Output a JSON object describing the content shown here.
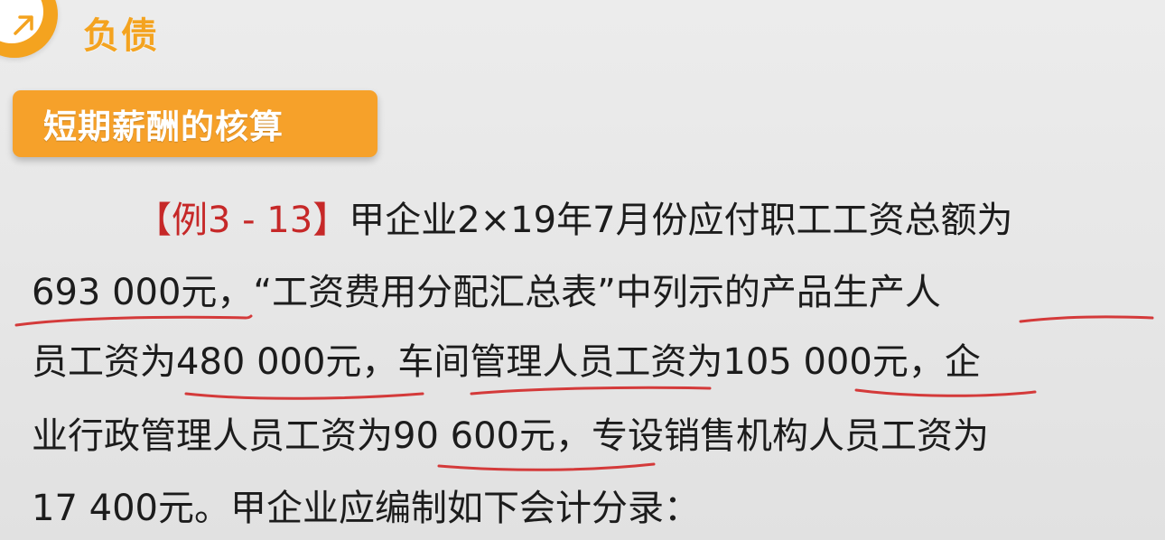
{
  "header": {
    "title": "负债",
    "icon": "arrow-up-right-icon",
    "accent_color": "#f4a31f"
  },
  "section": {
    "label": "短期薪酬的核算",
    "color": "#f6a12a"
  },
  "example": {
    "label": "【例3 - 13】",
    "label_color": "#c62828",
    "line1_rest": "甲企业2×19年7月份应付职工工资总额为",
    "line2_a": "693 000元，",
    "line2_b": "“工资费用分配汇总表”中列示的产品",
    "line2_c": "生产人",
    "line3_a": "员工资为",
    "line3_b": "480 000元，",
    "line3_c": "车间管理人员",
    "line3_d": "工资为",
    "line3_e": "105 000元，",
    "line3_f": "企",
    "line4_a": "业行政管理人员工资为",
    "line4_b": "90 600元，",
    "line4_c": "专设销售机构人员工资为",
    "line5": "17 400元。甲企业应编制如下会计分录："
  },
  "annotation_color": "#d43a3a"
}
